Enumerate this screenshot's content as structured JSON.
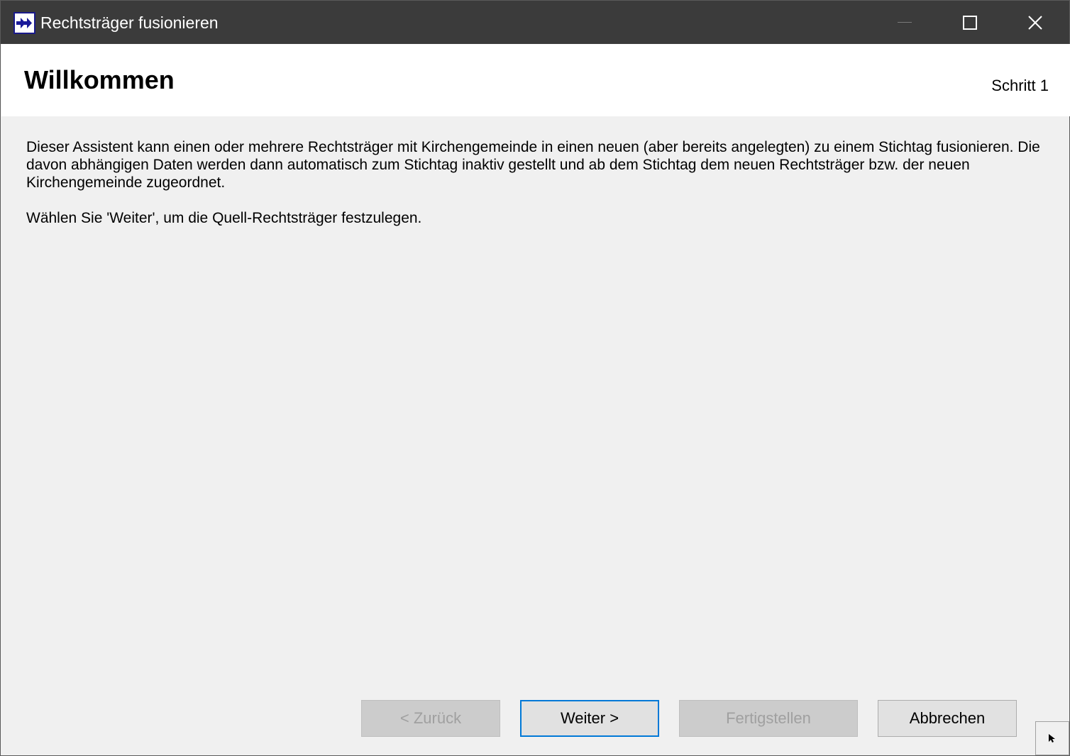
{
  "window": {
    "title": "Rechtsträger fusionieren"
  },
  "header": {
    "title": "Willkommen",
    "step": "Schritt 1"
  },
  "content": {
    "paragraph1": "Dieser Assistent kann einen oder mehrere Rechtsträger mit Kirchengemeinde in einen neuen (aber bereits angelegten) zu einem Stichtag fusionieren. Die davon abhängigen Daten werden dann automatisch zum Stichtag inaktiv gestellt und ab dem Stichtag dem neuen Rechtsträger bzw. der neuen Kirchengemeinde zugeordnet.",
    "paragraph2": "Wählen Sie 'Weiter', um die Quell-Rechtsträger festzulegen."
  },
  "buttons": {
    "back": "< Zurück",
    "next": "Weiter >",
    "finish": "Fertigstellen",
    "cancel": "Abbrechen"
  },
  "icons": {
    "app": "double-arrow-right-icon",
    "minimize": "minimize-icon",
    "maximize": "maximize-icon",
    "close": "close-icon",
    "help": "help-pointer-icon"
  },
  "colors": {
    "titlebar": "#3b3b3b",
    "header": "#ffffff",
    "body": "#f0f0f0",
    "focus_border": "#0078d7"
  }
}
